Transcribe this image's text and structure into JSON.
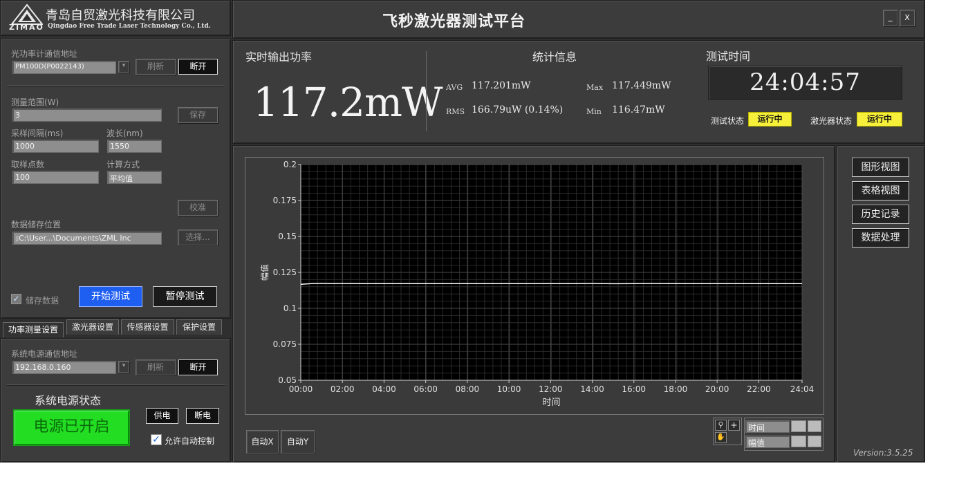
{
  "header": {
    "company_cn": "青岛自贸激光科技有限公司",
    "company_en": "Qingdao Free Trade Laser Technology Co., Ltd.",
    "logo_text": "ZIMAO",
    "title": "飞秒激光器测试平台",
    "minimize_label": "_",
    "close_label": "X"
  },
  "power_meter": {
    "addr_label": "光功率计通信地址",
    "addr_value": "PM100D(P0022143)",
    "refresh_label": "刷新",
    "disconnect_label": "断开",
    "range_label": "测量范围(W)",
    "range_value": "3",
    "save_label": "保存",
    "interval_label": "采样间隔(ms)",
    "interval_value": "1000",
    "wavelength_label": "波长(nm)",
    "wavelength_value": "1550",
    "samples_label": "取样点数",
    "samples_value": "100",
    "calc_label": "计算方式",
    "calc_value": "平均值",
    "calibrate_label": "校准",
    "storage_label": "数据储存位置",
    "storage_value": "C:\\User...\\Documents\\ZML Inc",
    "select_label": "选择...",
    "store_data_label": "储存数据",
    "start_label": "开始测试",
    "pause_label": "暂停测试"
  },
  "tabs": [
    {
      "label": "功率测量设置"
    },
    {
      "label": "激光器设置"
    },
    {
      "label": "传感器设置"
    },
    {
      "label": "保护设置"
    }
  ],
  "power_supply": {
    "addr_label": "系统电源通信地址",
    "addr_value": "192.168.0.160",
    "refresh_label": "刷新",
    "disconnect_label": "断开",
    "status_title": "系统电源状态",
    "status_value": "电源已开启",
    "power_on_label": "供电",
    "power_off_label": "断电",
    "auto_control_label": "允许自动控制",
    "on_color": "#22dd22"
  },
  "realtime": {
    "title": "实时输出功率",
    "value": "117.2mW"
  },
  "stats": {
    "title": "统计信息",
    "avg_key": "AVG",
    "avg_value": "117.201mW",
    "max_key": "Max",
    "max_value": "117.449mW",
    "rms_key": "RMS",
    "rms_value": "166.79uW (0.14%)",
    "min_key": "Min",
    "min_value": "116.47mW"
  },
  "test_time": {
    "title": "测试时间",
    "value": "24:04:57",
    "test_status_label": "测试状态",
    "test_status_value": "运行中",
    "laser_status_label": "激光器状态",
    "laser_status_value": "运行中",
    "status_color": "#f6f03a"
  },
  "views": [
    {
      "label": "图形视图"
    },
    {
      "label": "表格视图"
    },
    {
      "label": "历史记录"
    },
    {
      "label": "数据处理"
    }
  ],
  "chart_controls": {
    "auto_x": "自动X",
    "auto_y": "自动Y",
    "scale_time": "时间",
    "scale_amp": "幅值"
  },
  "version": "Version:3.5.25",
  "chart_data": {
    "type": "line",
    "xlabel": "时间",
    "ylabel": "幅值",
    "xlim": [
      0,
      24.08
    ],
    "ylim": [
      0.05,
      0.2
    ],
    "x_ticks": [
      "00:00",
      "02:00",
      "04:00",
      "06:00",
      "08:00",
      "10:00",
      "12:00",
      "14:00",
      "16:00",
      "18:00",
      "20:00",
      "22:00",
      "24:04"
    ],
    "x_tick_values": [
      0,
      2,
      4,
      6,
      8,
      10,
      12,
      14,
      16,
      18,
      20,
      22,
      24.08
    ],
    "y_ticks": [
      "0.2",
      "0.175",
      "0.15",
      "0.125",
      "0.1",
      "0.075",
      "0.05"
    ],
    "y_tick_values": [
      0.2,
      0.175,
      0.15,
      0.125,
      0.1,
      0.075,
      0.05
    ],
    "grid": true,
    "series": [
      {
        "x": [
          0,
          0.5,
          1,
          1.5,
          2,
          3,
          4,
          5,
          6,
          7,
          8,
          9,
          10,
          11,
          12,
          13,
          14,
          15,
          16,
          17,
          18,
          19,
          20,
          21,
          22,
          23,
          24.08
        ],
        "values": [
          0.1167,
          0.1172,
          0.1174,
          0.1172,
          0.1173,
          0.1172,
          0.1172,
          0.1172,
          0.1172,
          0.1172,
          0.1172,
          0.1172,
          0.1172,
          0.1172,
          0.1172,
          0.1172,
          0.1173,
          0.1171,
          0.1172,
          0.1173,
          0.1172,
          0.1172,
          0.1172,
          0.1172,
          0.1172,
          0.1172,
          0.1172
        ],
        "color": "#ffffff"
      }
    ]
  }
}
